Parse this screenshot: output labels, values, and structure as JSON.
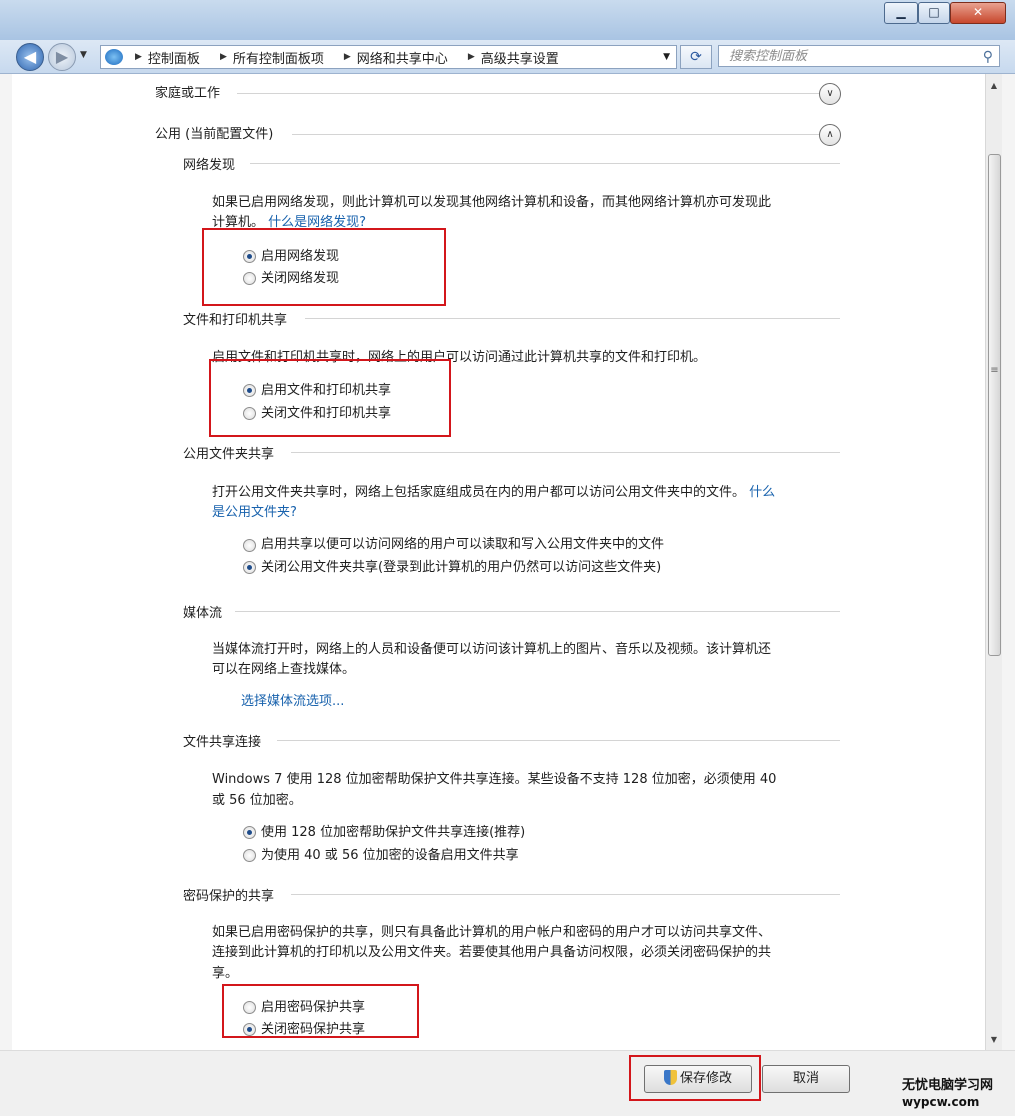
{
  "window": {
    "minimize": "▁",
    "maximize": "□",
    "close": "✕"
  },
  "nav": {
    "back_icon": "◀",
    "forward_icon": "▶",
    "breadcrumb": [
      "控制面板",
      "所有控制面板项",
      "网络和共享中心",
      "高级共享设置"
    ],
    "refresh_icon": "⟳",
    "search_placeholder": "搜索控制面板",
    "search_icon": "⚲"
  },
  "profiles": {
    "home": {
      "label": "家庭或工作",
      "chevron": "∨"
    },
    "public": {
      "label": "公用 (当前配置文件)",
      "chevron": "∧"
    }
  },
  "sections": {
    "network_discovery": {
      "title": "网络发现",
      "desc_line1": "如果已启用网络发现，则此计算机可以发现其他网络计算机和设备，而其他网络计算机亦可发现此",
      "desc_line2": "计算机。",
      "link": "什么是网络发现?",
      "options": [
        "启用网络发现",
        "关闭网络发现"
      ],
      "selected": 0
    },
    "file_printer": {
      "title": "文件和打印机共享",
      "desc": "启用文件和打印机共享时，网络上的用户可以访问通过此计算机共享的文件和打印机。",
      "options": [
        "启用文件和打印机共享",
        "关闭文件和打印机共享"
      ],
      "selected": 0
    },
    "public_folder": {
      "title": "公用文件夹共享",
      "desc_line1": "打开公用文件夹共享时，网络上包括家庭组成员在内的用户都可以访问公用文件夹中的文件。",
      "link_part1": "什么",
      "link_part2": "是公用文件夹?",
      "options": [
        "启用共享以便可以访问网络的用户可以读取和写入公用文件夹中的文件",
        "关闭公用文件夹共享(登录到此计算机的用户仍然可以访问这些文件夹)"
      ],
      "selected": 1
    },
    "media": {
      "title": "媒体流",
      "desc_line1": "当媒体流打开时，网络上的人员和设备便可以访问该计算机上的图片、音乐以及视频。该计算机还",
      "desc_line2": "可以在网络上查找媒体。",
      "link": "选择媒体流选项..."
    },
    "encryption": {
      "title": "文件共享连接",
      "desc_line1": "Windows 7 使用 128 位加密帮助保护文件共享连接。某些设备不支持 128 位加密，必须使用 40",
      "desc_line2": "或 56 位加密。",
      "options": [
        "使用 128 位加密帮助保护文件共享连接(推荐)",
        "为使用 40 或 56 位加密的设备启用文件共享"
      ],
      "selected": 0
    },
    "password": {
      "title": "密码保护的共享",
      "desc_line1": "如果已启用密码保护的共享，则只有具备此计算机的用户帐户和密码的用户才可以访问共享文件、",
      "desc_line2": "连接到此计算机的打印机以及公用文件夹。若要使其他用户具备访问权限，必须关闭密码保护的共",
      "desc_line3": "享。",
      "options": [
        "启用密码保护共享",
        "关闭密码保护共享"
      ],
      "selected": 1
    }
  },
  "footer": {
    "save": "保存修改",
    "cancel": "取消"
  },
  "watermark": {
    "name": "无忧电脑学习网",
    "url": "wypcw.com"
  },
  "colors": {
    "highlight": "#d3161b",
    "link": "#1862ad"
  }
}
